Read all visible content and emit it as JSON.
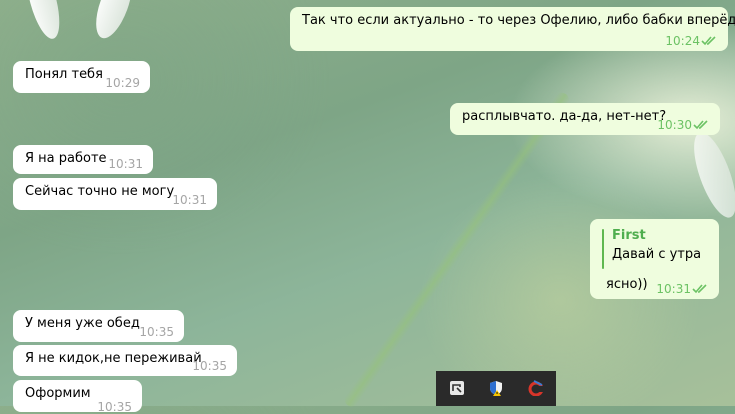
{
  "messages": [
    {
      "text": "Так что если актуально - то через Офелию, либо бабки вперёд.",
      "time": "10:24"
    },
    {
      "text": "Понял тебя",
      "time": "10:29"
    },
    {
      "text": "расплывчато. да-да, нет-нет?",
      "time": "10:30"
    },
    {
      "text": "Я на работе",
      "time": "10:31"
    },
    {
      "text": "Сейчас точно не могу",
      "time": "10:31"
    },
    {
      "text": "ясно))",
      "time": "10:31",
      "reply_name": "First",
      "reply_text": "Давай с утра"
    },
    {
      "text": "У меня уже обед",
      "time": "10:35"
    },
    {
      "text": "Я не кидок,не переживай",
      "time": "10:35"
    },
    {
      "text": "Оформим",
      "time": "10:35"
    }
  ],
  "colors": {
    "incoming_bubble": "#ffffff",
    "outgoing_bubble": "#effdde",
    "read_ticks": "#6cc264",
    "reply_accent": "#4fae4e"
  },
  "tray_icons": [
    "app-icon",
    "shield-warning-icon",
    "ccleaner-icon"
  ]
}
